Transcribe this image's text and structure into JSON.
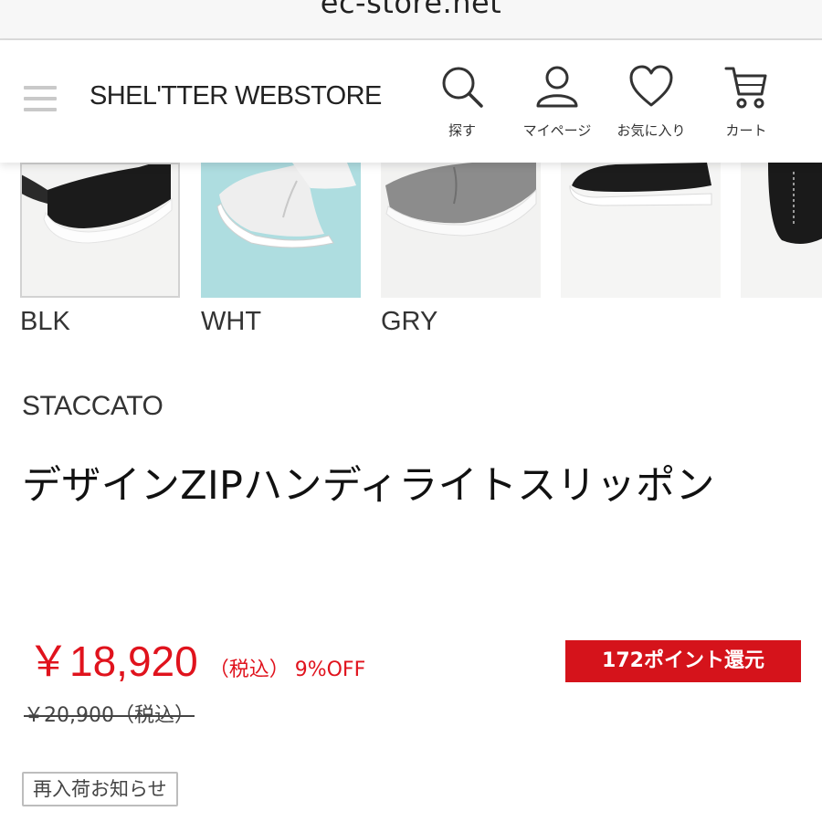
{
  "browser": {
    "url": "ec-store.net"
  },
  "header": {
    "store_title": "SHEL'TTER WEBSTORE",
    "nav": [
      {
        "label": "探す",
        "icon": "search-icon"
      },
      {
        "label": "マイページ",
        "icon": "user-icon"
      },
      {
        "label": "お気に入り",
        "icon": "heart-icon"
      },
      {
        "label": "カート",
        "icon": "cart-icon"
      }
    ]
  },
  "swatches": [
    {
      "label": "BLK",
      "selected": true
    },
    {
      "label": "WHT",
      "selected": false
    },
    {
      "label": "GRY",
      "selected": false
    },
    {
      "label": "",
      "selected": false
    },
    {
      "label": "",
      "selected": false
    }
  ],
  "product": {
    "brand": "STACCATO",
    "name": "デザインZIPハンディライトスリッポン",
    "price": "￥18,920",
    "tax_note": "（税込）",
    "discount": "9%OFF",
    "points": "172ポイント還元",
    "original_price": "￥20,900（税込）",
    "restock_button": "再入荷お知らせ"
  },
  "colors": {
    "price_red": "#e0131d",
    "points_bg": "#d5131b"
  }
}
